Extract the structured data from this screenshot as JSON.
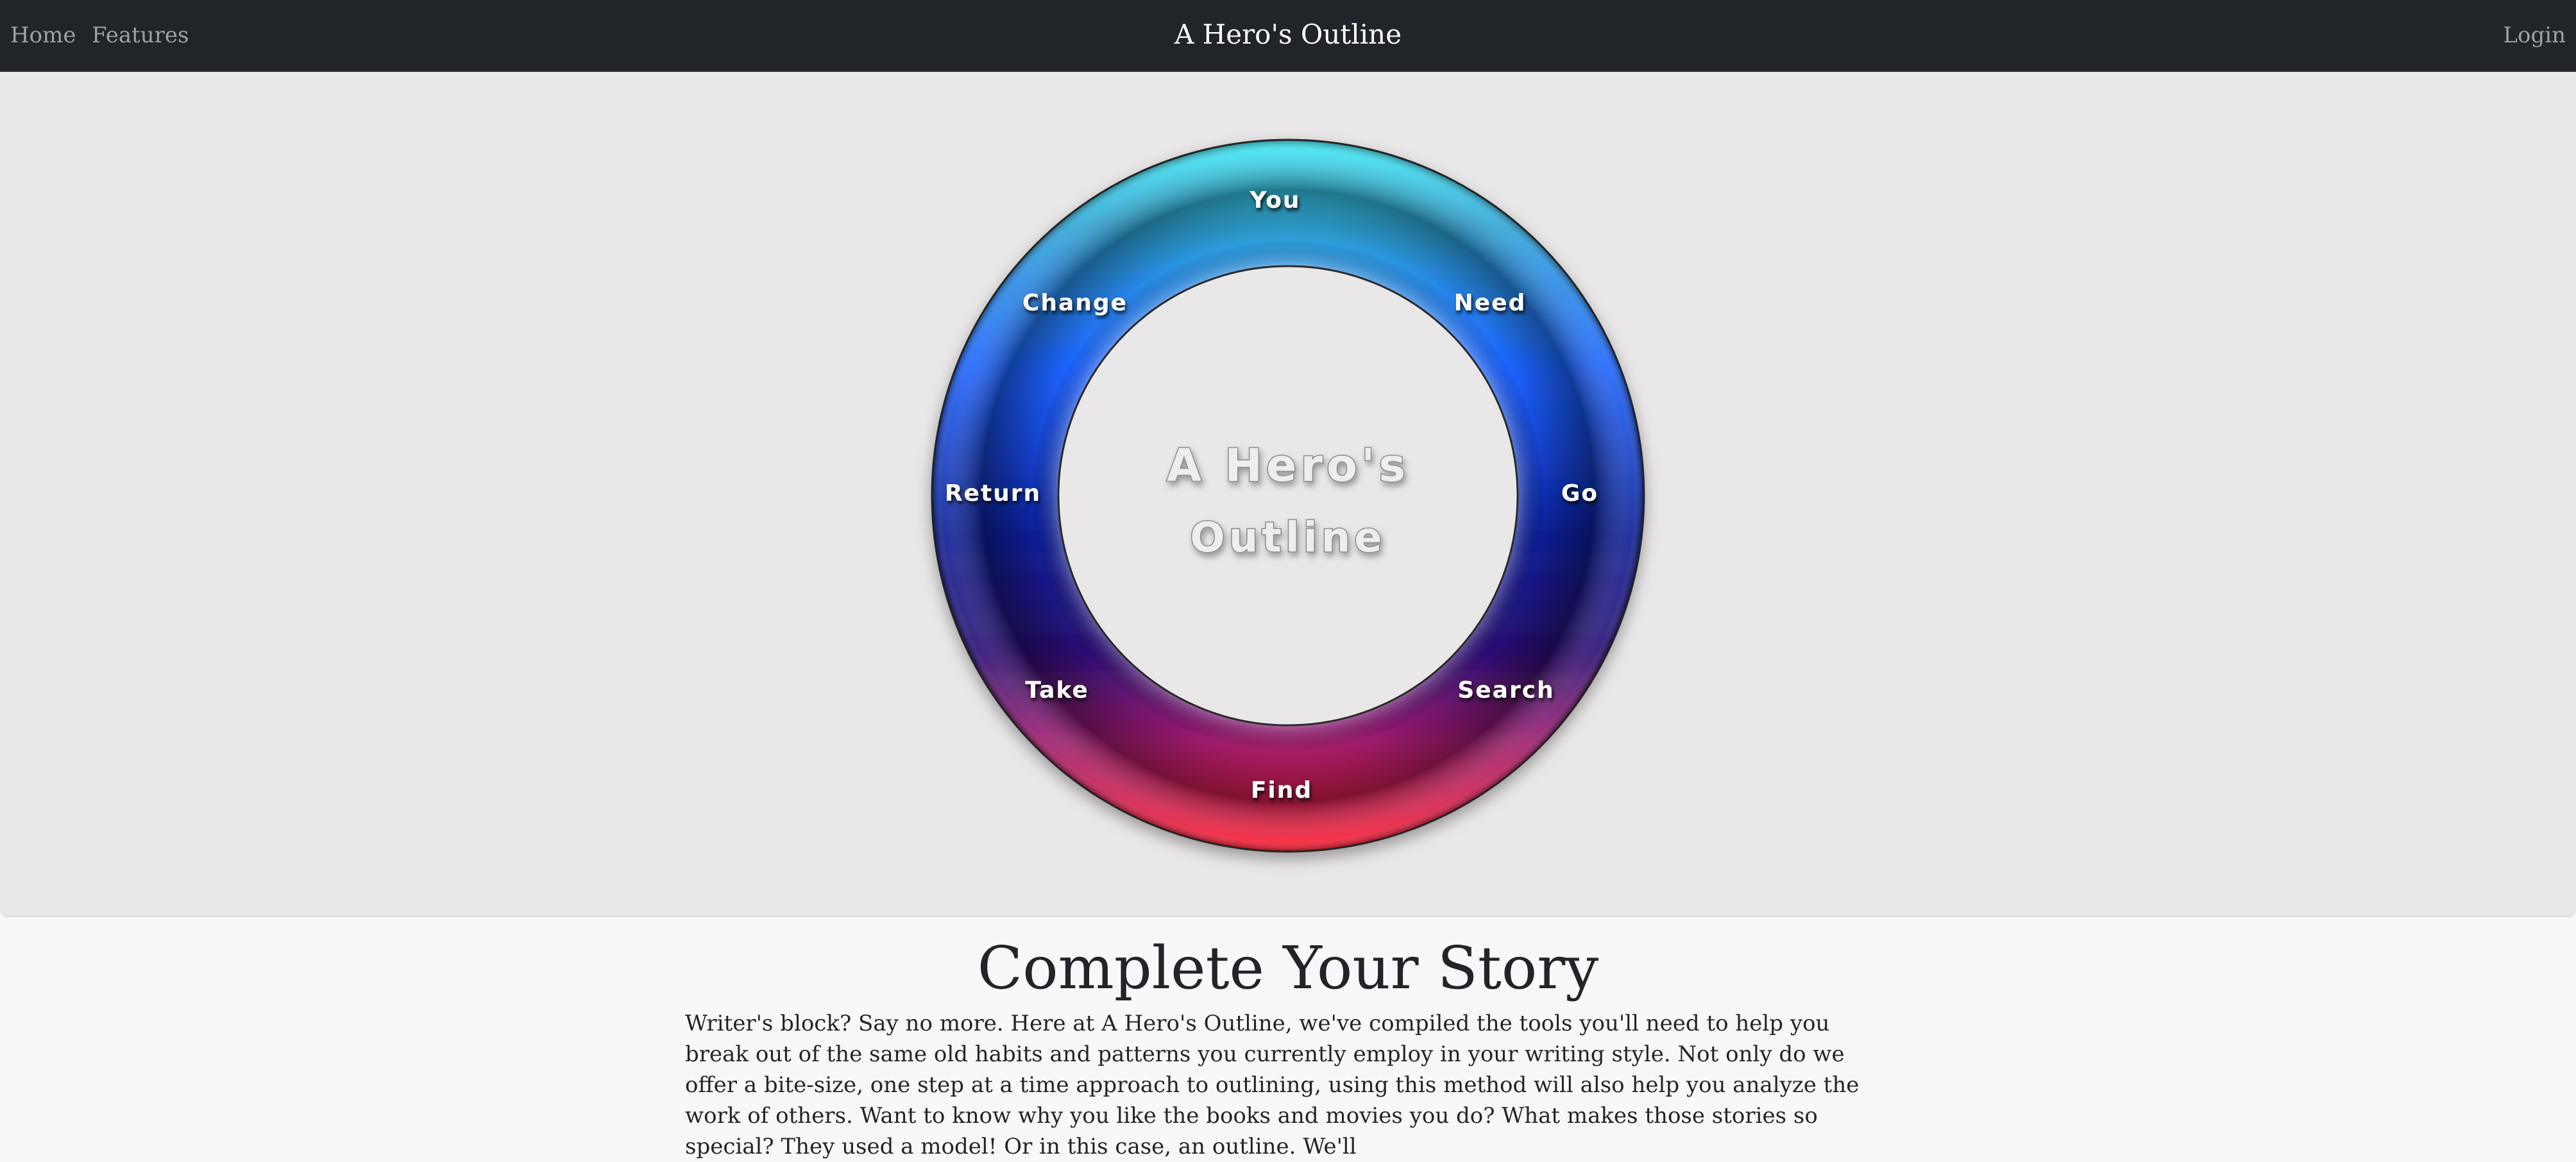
{
  "nav": {
    "home": "Home",
    "features": "Features",
    "brand": "A Hero's Outline",
    "login": "Login"
  },
  "wheel": {
    "center_line1": "A Hero's",
    "center_line2": "Outline",
    "steps": [
      "You",
      "Need",
      "Go",
      "Search",
      "Find",
      "Take",
      "Return",
      "Change"
    ],
    "colors": {
      "top": "#3ee6f2",
      "mid": "#1d63ff",
      "deep": "#0a1a8a",
      "pink": "#ff2a9e",
      "bottom": "#ff1f2f"
    }
  },
  "content": {
    "title": "Complete Your Story",
    "body": "Writer's block? Say no more. Here at A Hero's Outline, we've compiled the tools you'll need to help you break out of the same old habits and patterns you currently employ in your writing style. Not only do we offer a bite-size, one step at a time approach to outlining, using this method will also help you analyze the work of others. Want to know why you like the books and movies you do? What makes those stories so special? They used a model! Or in this case, an outline. We'll"
  }
}
